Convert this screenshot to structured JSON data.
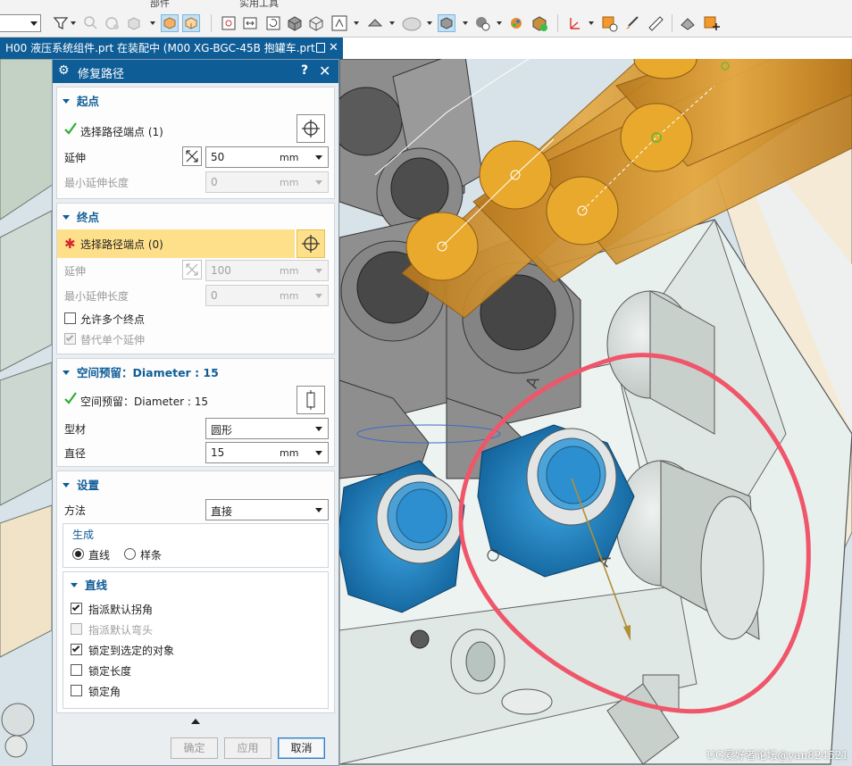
{
  "toolbar": {
    "group_labels": [
      "部件",
      "实用工具"
    ]
  },
  "tab": {
    "title": "H00 液压系统组件.prt 在装配中 (M00 XG-BGC-45B 抱罐车.prt",
    "close": "✕"
  },
  "dialog": {
    "title": "修复路径",
    "help": "?",
    "close": "✕",
    "start": {
      "header": "起点",
      "select_label": "选择路径端点 (1)",
      "extend_label": "延伸",
      "extend_value": "50",
      "extend_unit": "mm",
      "min_extend_label": "最小延伸长度",
      "min_extend_value": "0",
      "min_extend_unit": "mm"
    },
    "end": {
      "header": "终点",
      "select_label": "选择路径端点 (0)",
      "extend_label": "延伸",
      "extend_value": "100",
      "extend_unit": "mm",
      "min_extend_label": "最小延伸长度",
      "min_extend_value": "0",
      "min_extend_unit": "mm",
      "allow_multiple_label": "允许多个终点",
      "allow_multiple_checked": false,
      "alt_single_label": "替代单个延伸",
      "alt_single_checked": true
    },
    "clearance": {
      "header": "空间预留：Diameter : 15",
      "select_label": "空间预留：Diameter : 15",
      "profile_label": "型材",
      "profile_value": "圆形",
      "diameter_label": "直径",
      "diameter_value": "15",
      "diameter_unit": "mm"
    },
    "settings": {
      "header": "设置",
      "method_label": "方法",
      "method_value": "直接",
      "generate_label": "生成",
      "radio_line": "直线",
      "radio_spline": "样条",
      "selected": "直线",
      "line": {
        "header": "直线",
        "options": [
          {
            "label": "指派默认拐角",
            "checked": true,
            "enabled": true
          },
          {
            "label": "指派默认弯头",
            "checked": false,
            "enabled": false
          },
          {
            "label": "锁定到选定的对象",
            "checked": true,
            "enabled": true
          },
          {
            "label": "锁定长度",
            "checked": false,
            "enabled": true
          },
          {
            "label": "锁定角",
            "checked": false,
            "enabled": true
          }
        ]
      }
    },
    "buttons": {
      "ok": "确定",
      "apply": "应用",
      "cancel": "取消"
    }
  },
  "watermark": "UG爱好者论坛@yan824521",
  "colors": {
    "title_bar": "#0f5d97",
    "tube_orange": "#e0a33a",
    "fitting_blue": "#1e86c9",
    "annotation_red": "#f0566a",
    "required_highlight": "#ffe08a"
  }
}
